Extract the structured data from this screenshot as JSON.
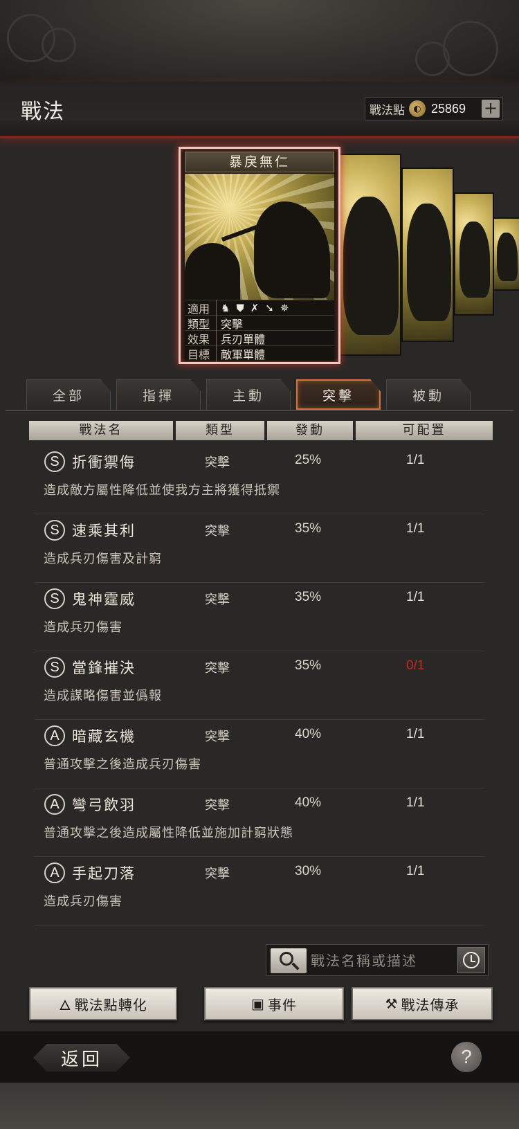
{
  "header": {
    "title": "戰法",
    "points_label": "戰法點",
    "points_value": "25869",
    "plus_label": "+"
  },
  "card": {
    "title": "暴戾無仁",
    "rows": [
      {
        "key": "適用",
        "units": [
          "horse-icon",
          "shield-icon",
          "bow-icon",
          "spear-icon",
          "wheel-icon"
        ]
      },
      {
        "key": "類型",
        "value": "突擊"
      },
      {
        "key": "效果",
        "value": "兵刃單體"
      },
      {
        "key": "目標",
        "value": "敵軍單體"
      }
    ]
  },
  "tabs": [
    {
      "label": "全部",
      "active": false
    },
    {
      "label": "指揮",
      "active": false
    },
    {
      "label": "主動",
      "active": false
    },
    {
      "label": "突擊",
      "active": true
    },
    {
      "label": "被動",
      "active": false
    }
  ],
  "columns": [
    "戰法名",
    "類型",
    "發動",
    "可配置"
  ],
  "tactics": [
    {
      "grade": "S",
      "name": "折衝禦侮",
      "type": "突擊",
      "rate": "25%",
      "slots": "1/1",
      "slots_red": false,
      "desc": "造成敵方屬性降低並使我方主將獲得抵禦"
    },
    {
      "grade": "S",
      "name": "速乘其利",
      "type": "突擊",
      "rate": "35%",
      "slots": "1/1",
      "slots_red": false,
      "desc": "造成兵刃傷害及計窮"
    },
    {
      "grade": "S",
      "name": "鬼神霆威",
      "type": "突擊",
      "rate": "35%",
      "slots": "1/1",
      "slots_red": false,
      "desc": "造成兵刃傷害"
    },
    {
      "grade": "S",
      "name": "當鋒摧決",
      "type": "突擊",
      "rate": "35%",
      "slots": "0/1",
      "slots_red": true,
      "desc": "造成謀略傷害並僞報"
    },
    {
      "grade": "A",
      "name": "暗藏玄機",
      "type": "突擊",
      "rate": "40%",
      "slots": "1/1",
      "slots_red": false,
      "desc": "普通攻擊之後造成兵刃傷害"
    },
    {
      "grade": "A",
      "name": "彎弓飲羽",
      "type": "突擊",
      "rate": "40%",
      "slots": "1/1",
      "slots_red": false,
      "desc": "普通攻擊之後造成屬性降低並施加計窮狀態"
    },
    {
      "grade": "A",
      "name": "手起刀落",
      "type": "突擊",
      "rate": "30%",
      "slots": "1/1",
      "slots_red": false,
      "desc": "造成兵刃傷害"
    }
  ],
  "search": {
    "placeholder": "戰法名稱或描述"
  },
  "buttons": {
    "convert": "戰法點轉化",
    "events": "事件",
    "inherit": "戰法傳承"
  },
  "footer": {
    "back": "返回",
    "help": "?"
  },
  "colors": {
    "accent_red": "#c8281e",
    "tab_active_border": "#d4743a"
  }
}
